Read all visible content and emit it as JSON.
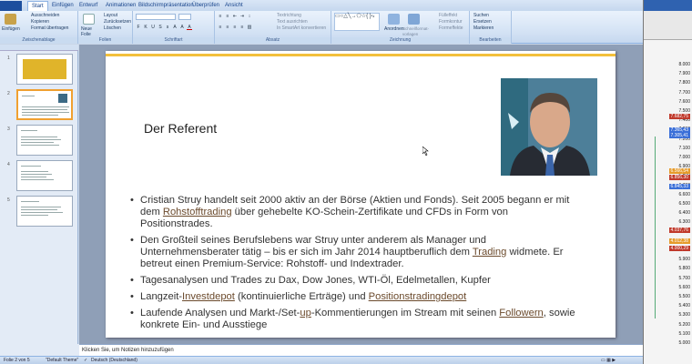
{
  "ribbon": {
    "tabs": [
      "Start",
      "Einfügen",
      "Entwurf",
      "Animationen",
      "Bildschirmpräsentation",
      "Überprüfen",
      "Ansicht"
    ],
    "active_tab": "Start",
    "clipboard": {
      "paste": "Einfügen",
      "cut": "Ausschneiden",
      "copy": "Kopieren",
      "format": "Format übertragen",
      "group": "Zwischenablage"
    },
    "slides": {
      "new": "Neue Folie",
      "layout": "Layout",
      "reset": "Zurücksetzen",
      "delete": "Löschen",
      "group": "Folien"
    },
    "font": {
      "group": "Schriftart"
    },
    "paragraph": {
      "direction": "Textrichtung",
      "align": "Text ausrichten",
      "smartart": "In SmartArt konvertieren",
      "group": "Absatz"
    },
    "drawing": {
      "arrange": "Anordnen",
      "quick_styles": "Schnellformat-vorlagen",
      "fill": "Fülleffekt",
      "outline": "Formkontur",
      "effects": "Formeffekte",
      "group": "Zeichnung"
    },
    "editing": {
      "find": "Suchen",
      "replace": "Ersetzen",
      "select": "Markieren",
      "group": "Bearbeiten"
    }
  },
  "thumbnails": [
    "1",
    "2",
    "3",
    "4",
    "5"
  ],
  "slide": {
    "title": "Der Referent",
    "bullets": [
      {
        "a": "Cristian Struy handelt seit 2000 aktiv an der Börse (Aktien und Fonds). Seit 2005 begann er mit dem ",
        "u1": "Rohstofftrading",
        "b": " über gehebelte KO-Schein-Zertifikate und CFDs in Form von Positionstrades."
      },
      {
        "a": "Den Großteil seines Berufslebens war Struy unter anderem als Manager und Unternehmensberater tätig – bis er sich im Jahr 2014 hauptberuflich dem ",
        "u1": "Trading",
        "b": " widmete. Er betreut einen Premium-Service: Rohstoff- und Indextrader."
      },
      {
        "a": "Tagesanalysen und Trades zu Dax, Dow Jones, WTI-Öl, Edelmetallen, Kupfer"
      },
      {
        "a": "Langzeit-",
        "u1": "Investdepot",
        "b": " (kontinuierliche Erträge) und ",
        "u2": "Positionstradingdepot"
      },
      {
        "a": "Laufende Analysen und Markt-/Set-",
        "u1": "up",
        "b": "-Kommentierungen im Stream mit seinen ",
        "u2": "Followern",
        "c": ", sowie konkrete Ein- und Ausstiege"
      }
    ]
  },
  "notes_placeholder": "Klicken Sie, um Notizen hinzuzufügen",
  "status": {
    "slide": "Folie 2 von 5",
    "theme": "\"Default Theme\"",
    "language": "Deutsch (Deutschland)"
  },
  "side_prices": [
    "8.000",
    "7.900",
    "7.800",
    "7.700",
    "7.600",
    "7.500",
    "7.400",
    "7.300",
    "7.200",
    "7.100",
    "7.000",
    "6.900",
    "6.800",
    "6.700",
    "6.600",
    "6.500",
    "6.400",
    "6.300",
    "6.200",
    "6.100",
    "6.000",
    "5.900",
    "5.800",
    "5.700",
    "5.600",
    "5.500",
    "5.400",
    "5.300",
    "5.200",
    "5.100",
    "5.000"
  ],
  "side_boxes": [
    "7.682,75",
    "7.365,43",
    "7.305,41",
    "6.856,30",
    "6.845,33",
    "6.566,54",
    "4.037,76",
    "4.012,38",
    "4.000,29"
  ],
  "colors": {
    "accent": "#f3c03b",
    "ribbon": "#d6e4f5",
    "box_red": "#c0392b",
    "box_blue": "#3a6fd8",
    "box_orange": "#e69b2a"
  }
}
